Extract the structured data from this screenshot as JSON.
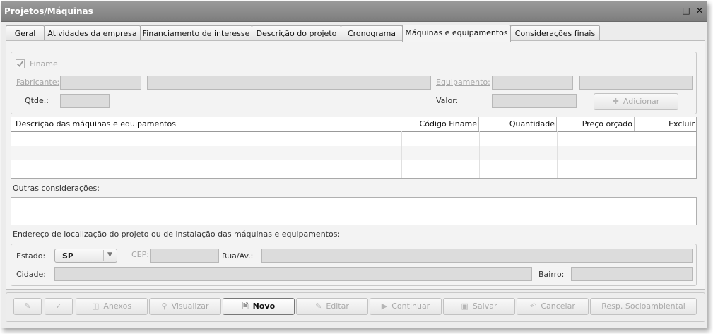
{
  "window": {
    "title": "Projetos/Máquinas"
  },
  "window_controls": [
    "minimize-icon",
    "maximize-icon",
    "close-icon"
  ],
  "tabs": [
    {
      "label": "Geral"
    },
    {
      "label": "Atividades da empresa"
    },
    {
      "label": "Financiamento de interesse"
    },
    {
      "label": "Descrição do projeto"
    },
    {
      "label": "Cronograma"
    },
    {
      "label": "Máquinas e equipamentos",
      "active": true
    },
    {
      "label": "Considerações finais"
    }
  ],
  "form": {
    "finame_label": "Finame",
    "finame_checked": true,
    "fabricante_label": "Fabricante:",
    "equipamento_label": "Equipamento:",
    "qtde_label": "Qtde.:",
    "valor_label": "Valor:",
    "adicionar_label": "Adicionar",
    "adicionar_icon": "plus-icon"
  },
  "table": {
    "columns": [
      "Descrição das máquinas e equipamentos",
      "Código Finame",
      "Quantidade",
      "Preço orçado",
      "Excluir"
    ],
    "rows": []
  },
  "outras_consideracoes_label": "Outras considerações:",
  "endereco": {
    "section_label": "Endereço de localização do projeto ou de instalação das máquinas e equipamentos:",
    "estado_label": "Estado:",
    "estado_value": "SP",
    "cep_label": "CEP:",
    "rua_label": "Rua/Av.:",
    "cidade_label": "Cidade:",
    "bairro_label": "Bairro:"
  },
  "toolbar": {
    "btn1_icon": "edit-note-icon",
    "btn2_icon": "check-note-icon",
    "anexos_label": "Anexos",
    "anexos_icon": "paperclip-icon",
    "visualizar_label": "Visualizar",
    "visualizar_icon": "magnifier-icon",
    "novo_label": "Novo",
    "novo_icon": "new-document-icon",
    "editar_label": "Editar",
    "editar_icon": "pencil-icon",
    "continuar_label": "Continuar",
    "continuar_icon": "play-icon",
    "salvar_label": "Salvar",
    "salvar_icon": "floppy-icon",
    "cancelar_label": "Cancelar",
    "cancelar_icon": "undo-arrow-icon",
    "resp_label": "Resp. Socioambiental"
  }
}
